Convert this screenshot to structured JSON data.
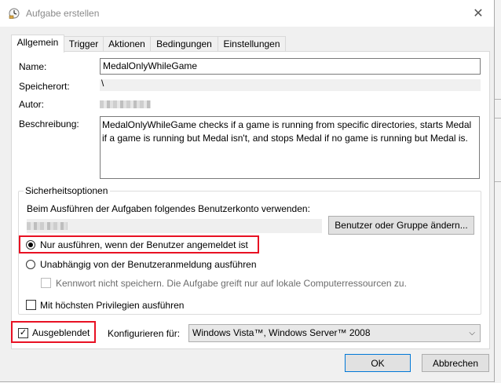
{
  "window": {
    "title": "Aufgabe erstellen",
    "close_glyph": "✕"
  },
  "tabs": [
    {
      "label": "Allgemein",
      "active": true
    },
    {
      "label": "Trigger"
    },
    {
      "label": "Aktionen"
    },
    {
      "label": "Bedingungen"
    },
    {
      "label": "Einstellungen"
    }
  ],
  "general": {
    "name_label": "Name:",
    "name_value": "MedalOnlyWhileGame",
    "location_label": "Speicherort:",
    "location_value": "\\",
    "author_label": "Autor:",
    "description_label": "Beschreibung:",
    "description_value": "MedalOnlyWhileGame checks if a game is running from specific directories, starts Medal if a game is running but Medal isn't, and stops Medal if no game is running but Medal is."
  },
  "security": {
    "group_title": "Sicherheitsoptionen",
    "account_prompt": "Beim Ausführen der Aufgaben folgendes Benutzerkonto verwenden:",
    "change_user_button": "Benutzer oder Gruppe ändern...",
    "radio_logged_on": "Nur ausführen, wenn der Benutzer angemeldet ist",
    "radio_logged_on_selected": true,
    "radio_independent": "Unabhängig von der Benutzeranmeldung ausführen",
    "no_store_password": "Kennwort nicht speichern. Die Aufgabe greift nur auf lokale Computerressourcen zu.",
    "highest_privileges": "Mit höchsten Privilegien ausführen"
  },
  "footer": {
    "hidden_label": "Ausgeblendet",
    "hidden_checked": true,
    "check_glyph": "✓",
    "configure_label": "Konfigurieren für:",
    "configure_value": "Windows Vista™, Windows Server™ 2008",
    "ok_button": "OK",
    "cancel_button": "Abbrechen"
  },
  "annotation_color": "#e81123"
}
